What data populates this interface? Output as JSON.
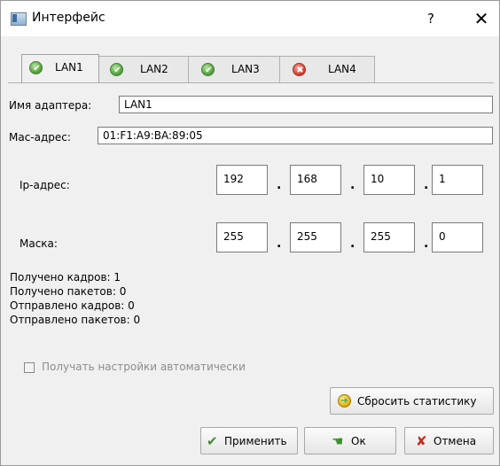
{
  "window": {
    "title": "Интерфейс",
    "help_label": "?",
    "close_label": "✕"
  },
  "tabs": [
    {
      "label": "LAN1",
      "status": "ok",
      "active": true
    },
    {
      "label": "LAN2",
      "status": "ok",
      "active": false
    },
    {
      "label": "LAN3",
      "status": "ok",
      "active": false
    },
    {
      "label": "LAN4",
      "status": "error",
      "active": false
    }
  ],
  "form": {
    "adapter_name_label": "Имя адаптера:",
    "adapter_name_value": "LAN1",
    "mac_label": "Mac-адрес:",
    "mac_value": "01:F1:A9:BA:89:05",
    "ip_label": "Ip-адрес:",
    "ip_octets": [
      "192",
      "168",
      "10",
      "1"
    ],
    "mask_label": "Маска:",
    "mask_octets": [
      "255",
      "255",
      "255",
      "0"
    ],
    "dot": "."
  },
  "stats": {
    "frames_received": "Получено кадров: 1",
    "packets_received": "Получено пакетов: 0",
    "frames_sent": "Отправлено кадров: 0",
    "packets_sent": "Отправлено пакетов: 0"
  },
  "auto_settings": {
    "label": "Получать настройки автоматически",
    "checked": false,
    "enabled": false
  },
  "buttons": {
    "reset_stats": "Сбросить статистику",
    "apply": "Применить",
    "ok": "Ок",
    "cancel": "Отмена"
  },
  "colors": {
    "ok_icon": "#4c9a36",
    "error_icon": "#d0392b",
    "disabled_text": "#8c8c8c"
  },
  "icons": {
    "tab_ok": "check-circle-icon",
    "tab_error": "x-circle-icon",
    "apply": "checkmark-icon",
    "ok": "hand-arrow-icon",
    "cancel": "x-icon",
    "reset": "refresh-icon"
  }
}
